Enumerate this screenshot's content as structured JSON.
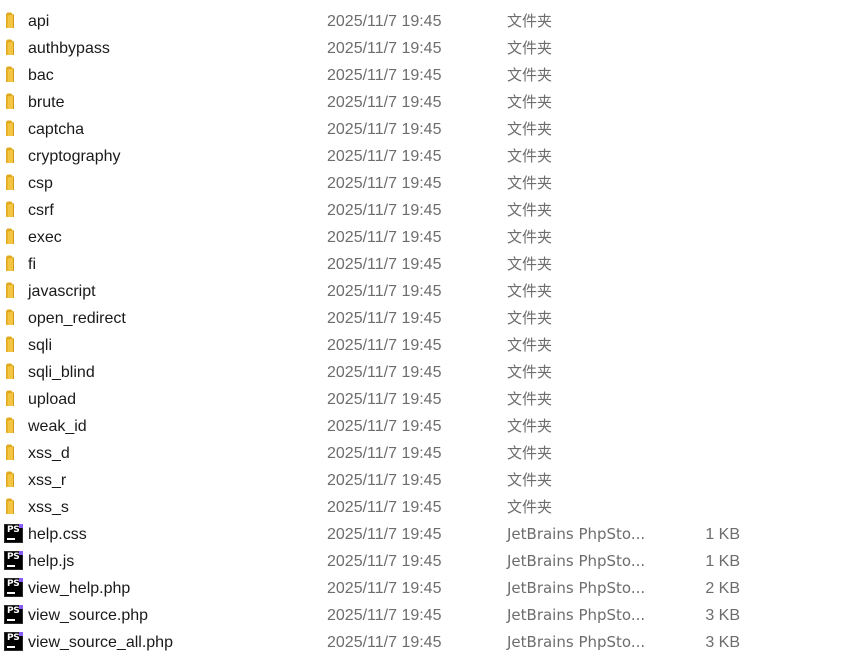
{
  "items": [
    {
      "name": "api",
      "date": "2025/11/7 19:45",
      "type": "文件夹",
      "size": "",
      "icon": "folder-icon"
    },
    {
      "name": "authbypass",
      "date": "2025/11/7 19:45",
      "type": "文件夹",
      "size": "",
      "icon": "folder-icon"
    },
    {
      "name": "bac",
      "date": "2025/11/7 19:45",
      "type": "文件夹",
      "size": "",
      "icon": "folder-icon"
    },
    {
      "name": "brute",
      "date": "2025/11/7 19:45",
      "type": "文件夹",
      "size": "",
      "icon": "folder-icon"
    },
    {
      "name": "captcha",
      "date": "2025/11/7 19:45",
      "type": "文件夹",
      "size": "",
      "icon": "folder-icon"
    },
    {
      "name": "cryptography",
      "date": "2025/11/7 19:45",
      "type": "文件夹",
      "size": "",
      "icon": "folder-icon"
    },
    {
      "name": "csp",
      "date": "2025/11/7 19:45",
      "type": "文件夹",
      "size": "",
      "icon": "folder-icon"
    },
    {
      "name": "csrf",
      "date": "2025/11/7 19:45",
      "type": "文件夹",
      "size": "",
      "icon": "folder-icon"
    },
    {
      "name": "exec",
      "date": "2025/11/7 19:45",
      "type": "文件夹",
      "size": "",
      "icon": "folder-icon"
    },
    {
      "name": "fi",
      "date": "2025/11/7 19:45",
      "type": "文件夹",
      "size": "",
      "icon": "folder-icon"
    },
    {
      "name": "javascript",
      "date": "2025/11/7 19:45",
      "type": "文件夹",
      "size": "",
      "icon": "folder-icon"
    },
    {
      "name": "open_redirect",
      "date": "2025/11/7 19:45",
      "type": "文件夹",
      "size": "",
      "icon": "folder-icon"
    },
    {
      "name": "sqli",
      "date": "2025/11/7 19:45",
      "type": "文件夹",
      "size": "",
      "icon": "folder-icon"
    },
    {
      "name": "sqli_blind",
      "date": "2025/11/7 19:45",
      "type": "文件夹",
      "size": "",
      "icon": "folder-icon"
    },
    {
      "name": "upload",
      "date": "2025/11/7 19:45",
      "type": "文件夹",
      "size": "",
      "icon": "folder-icon"
    },
    {
      "name": "weak_id",
      "date": "2025/11/7 19:45",
      "type": "文件夹",
      "size": "",
      "icon": "folder-icon"
    },
    {
      "name": "xss_d",
      "date": "2025/11/7 19:45",
      "type": "文件夹",
      "size": "",
      "icon": "folder-icon"
    },
    {
      "name": "xss_r",
      "date": "2025/11/7 19:45",
      "type": "文件夹",
      "size": "",
      "icon": "folder-icon"
    },
    {
      "name": "xss_s",
      "date": "2025/11/7 19:45",
      "type": "文件夹",
      "size": "",
      "icon": "folder-icon"
    },
    {
      "name": "help.css",
      "date": "2025/11/7 19:45",
      "type": "JetBrains PhpSto...",
      "size": "1 KB",
      "icon": "phpstorm-file-icon"
    },
    {
      "name": "help.js",
      "date": "2025/11/7 19:45",
      "type": "JetBrains PhpSto...",
      "size": "1 KB",
      "icon": "phpstorm-file-icon"
    },
    {
      "name": "view_help.php",
      "date": "2025/11/7 19:45",
      "type": "JetBrains PhpSto...",
      "size": "2 KB",
      "icon": "phpstorm-file-icon"
    },
    {
      "name": "view_source.php",
      "date": "2025/11/7 19:45",
      "type": "JetBrains PhpSto...",
      "size": "3 KB",
      "icon": "phpstorm-file-icon"
    },
    {
      "name": "view_source_all.php",
      "date": "2025/11/7 19:45",
      "type": "JetBrains PhpSto...",
      "size": "3 KB",
      "icon": "phpstorm-file-icon"
    }
  ],
  "icon_labels": {
    "phpstorm": "PS"
  },
  "colors": {
    "folder_yellow": "#f4c542",
    "folder_dark": "#e0a81c",
    "secondary_text": "#6d6d6d",
    "primary_text": "#1a1a1a"
  }
}
